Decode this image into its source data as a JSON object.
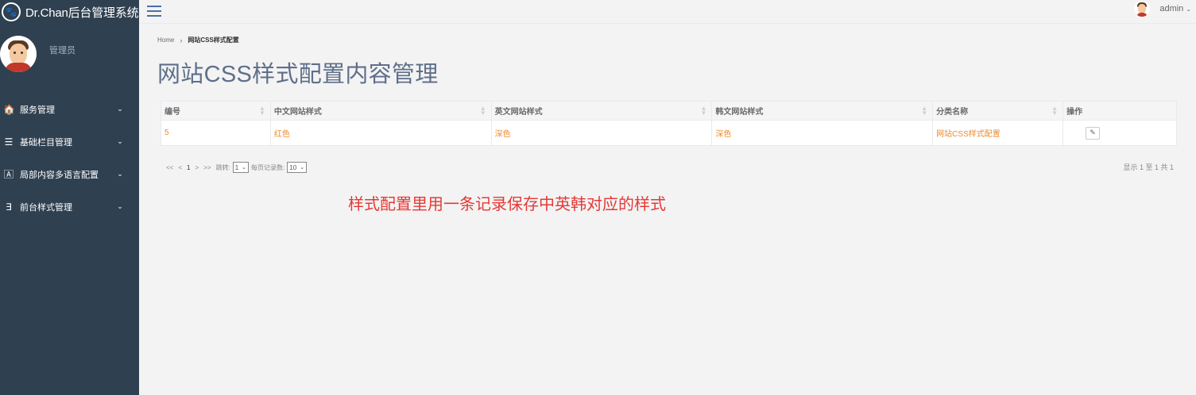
{
  "app": {
    "title": "Dr.Chan后台管理系统",
    "brand_color": "#2f4050"
  },
  "profile": {
    "role": "管理员"
  },
  "sidebar": {
    "items": [
      {
        "icon": "home-icon",
        "glyph": "🏠",
        "label": "服务管理"
      },
      {
        "icon": "list-icon",
        "glyph": "☰",
        "label": "基础栏目管理"
      },
      {
        "icon": "language-icon",
        "glyph": "🄰",
        "label": "局部内容多语言配置"
      },
      {
        "icon": "css3-icon",
        "glyph": "∃",
        "label": "前台样式管理"
      }
    ]
  },
  "topbar": {
    "user": "admin"
  },
  "breadcrumb": {
    "home": "Home",
    "current": "网站CSS样式配置"
  },
  "page": {
    "title": "网站CSS样式配置内容管理"
  },
  "table": {
    "headers": [
      "编号",
      "中文网站样式",
      "英文网站样式",
      "韩文网站样式",
      "分类名称",
      "操作"
    ],
    "rows": [
      {
        "id": "5",
        "zh": "红色",
        "en": "深色",
        "ko": "深色",
        "category": "网站CSS样式配置"
      }
    ]
  },
  "pager": {
    "first": "<<",
    "prev": "<",
    "current": "1",
    "next": ">",
    "last": ">>",
    "jump_label": "跳转:",
    "jump_value": "1",
    "size_label": "每页记录数:",
    "size_value": "10",
    "info": "显示 1 至 1 共 1"
  },
  "annotation": "样式配置里用一条记录保存中英韩对应的样式",
  "colors": {
    "cell_text": "#ed8a2b",
    "annotation": "#e53935",
    "title": "#5f6f89"
  }
}
